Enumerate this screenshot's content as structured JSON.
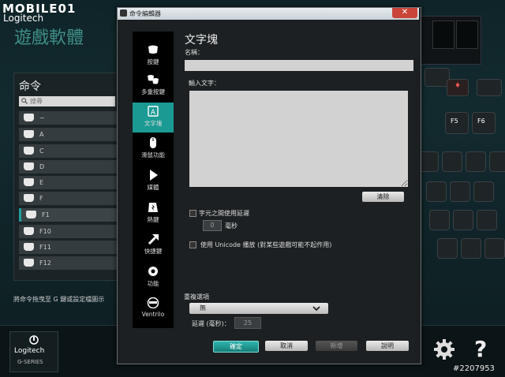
{
  "app": {
    "watermark_logo": "MOBILE01",
    "brand": "Logitech",
    "title": "遊戲軟體",
    "commands_title": "命令",
    "search_placeholder": "搜尋",
    "commands": [
      "~",
      "A",
      "C",
      "D",
      "E",
      "F",
      "F1",
      "F10",
      "F11",
      "F12"
    ],
    "selected_command": "F1",
    "drag_hint": "將命令拖曳至 G 鍵或設定檔圖示",
    "bottom_brand": "Logitech",
    "bottom_series": "G-SERIES",
    "keys_visible": [
      "F5",
      "F6"
    ],
    "image_id": "#2207953"
  },
  "dialog": {
    "title": "命令編輯器",
    "close_symbol": "✕",
    "nav": [
      {
        "label": "按鍵",
        "icon": "key-icon"
      },
      {
        "label": "多重按鍵",
        "icon": "multi-key-icon"
      },
      {
        "label": "文字塊",
        "icon": "text-block-icon"
      },
      {
        "label": "滑鼠功能",
        "icon": "mouse-icon"
      },
      {
        "label": "媒體",
        "icon": "play-icon"
      },
      {
        "label": "熱鍵",
        "icon": "hotkey-icon"
      },
      {
        "label": "快捷鍵",
        "icon": "shortcut-arrow-icon"
      },
      {
        "label": "功能",
        "icon": "function-gear-icon"
      },
      {
        "label": "Ventrilo",
        "icon": "ventrilo-icon"
      }
    ],
    "active_nav": "文字塊",
    "section_title": "文字塊",
    "name_label": "名稱：",
    "name_value": "",
    "text_label": "輸入文字：",
    "text_value": "",
    "clear_label": "清除",
    "delay_between_chars_label": "字元之間使用延遲",
    "delay_value": "0",
    "ms_label": "毫秒",
    "unicode_label": "使用 Unicode 播放 (對某些遊戲可能不起作用)",
    "repeat_label": "重複選項",
    "repeat_value": "無",
    "repeat_delay_label": "延遲 (毫秒)：",
    "repeat_delay_value": "25",
    "ok_label": "確定",
    "cancel_label": "取消",
    "test_label": "新增",
    "help_label": "說明"
  },
  "colors": {
    "accent": "#1b9a93",
    "close_button": "#c9453a",
    "app_title": "#3f8f87"
  }
}
